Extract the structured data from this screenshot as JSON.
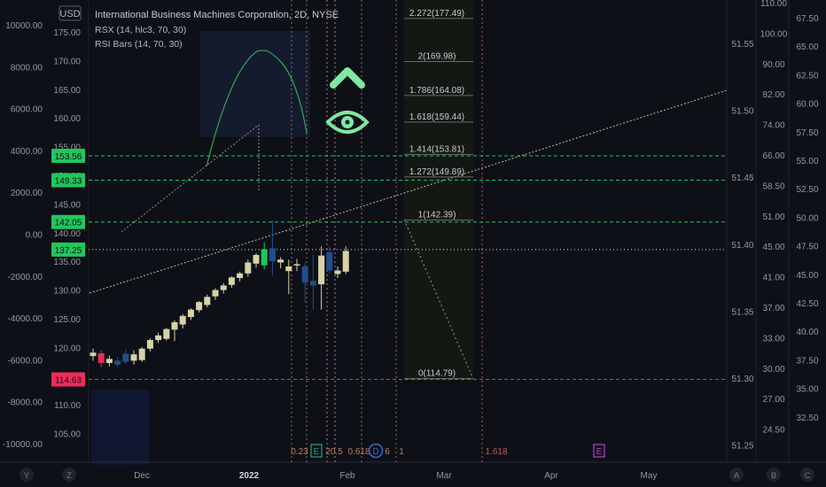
{
  "header": {
    "currency_badge": "USD",
    "title": "International Business Machines Corporation, 2D, NYSE",
    "indicators": [
      "RSX (14, hlc3, 70, 30)",
      "RSI Bars (14, 70, 30)"
    ]
  },
  "colors": {
    "background": "#0d1017",
    "up_candle": "#d8d2a8",
    "down_candle": "#1f4e8c",
    "bull_candle": "#22c55e",
    "bear_candle": "#ef2b5a",
    "green_line": "#22c55e",
    "red_line": "#ef2b5a",
    "fib_line": "#7a7a7a",
    "arrow": "#7ee8a0"
  },
  "axes": {
    "far_left": [
      "10000.00",
      "8000.00",
      "6000.00",
      "4000.00",
      "2000.00",
      "0.00",
      "-2000.00",
      "-4000.00",
      "-6000.00",
      "-8000.00",
      "-10000.00"
    ],
    "price": [
      "175.00",
      "170.00",
      "165.00",
      "160.00",
      "155.00",
      "150.00",
      "145.00",
      "140.00",
      "135.00",
      "130.00",
      "125.00",
      "120.00",
      "115.00",
      "110.00",
      "105.00"
    ],
    "mid_right": [
      "51.55",
      "51.50",
      "51.45",
      "51.40",
      "51.35",
      "51.30",
      "51.25"
    ],
    "right_a": [
      "110.00",
      "100.00",
      "90.00",
      "82.00",
      "74.00",
      "66.00",
      "58.50",
      "51.00",
      "45.00",
      "41.00",
      "37.00",
      "33.00",
      "30.00",
      "27.00",
      "24.50"
    ],
    "right_b": [
      "67.50",
      "65.00",
      "62.50",
      "60.00",
      "57.50",
      "55.00",
      "52.50",
      "50.00",
      "47.50",
      "45.00",
      "42.50",
      "40.00",
      "37.50",
      "35.00",
      "32.50"
    ],
    "time": [
      "Dec",
      "2022",
      "Feb",
      "Mar",
      "Apr",
      "May"
    ],
    "bottom_buttons": [
      "Y",
      "Z",
      "A",
      "B",
      "C"
    ]
  },
  "price_tags": [
    {
      "label": "153.56",
      "color": "#22c55e"
    },
    {
      "label": "149.33",
      "color": "#22c55e"
    },
    {
      "label": "142.05",
      "color": "#22c55e"
    },
    {
      "label": "137.25",
      "color": "#22c55e"
    },
    {
      "label": "114.63",
      "color": "#ef2b5a"
    }
  ],
  "fib_levels": [
    "2.272(177.49)",
    "2(169.98)",
    "1.786(164.08)",
    "1.618(159.44)",
    "1.414(153.81)",
    "1.272(149.89)",
    "1(142.39)",
    "0(114.79)"
  ],
  "bottom_labels": {
    "items": [
      "0.23",
      "E",
      "20.5",
      "0.618",
      "D",
      "6",
      "1",
      "1.618",
      "E"
    ]
  },
  "chart_data": {
    "type": "candlestick",
    "title": "International Business Machines Corporation, 2D, NYSE",
    "ylim": [
      102,
      179
    ],
    "candles": [
      {
        "o": 118.7,
        "h": 120.0,
        "l": 117.9,
        "c": 119.3
      },
      {
        "o": 119.2,
        "h": 119.7,
        "l": 116.8,
        "c": 117.5
      },
      {
        "o": 117.5,
        "h": 118.8,
        "l": 116.9,
        "c": 118.2
      },
      {
        "o": 117.9,
        "h": 118.5,
        "l": 116.8,
        "c": 117.2
      },
      {
        "o": 119.1,
        "h": 119.9,
        "l": 117.3,
        "c": 117.7
      },
      {
        "o": 117.9,
        "h": 119.7,
        "l": 117.2,
        "c": 119.0
      },
      {
        "o": 118.0,
        "h": 120.3,
        "l": 117.7,
        "c": 120.0
      },
      {
        "o": 120.0,
        "h": 121.8,
        "l": 119.5,
        "c": 121.5
      },
      {
        "o": 121.5,
        "h": 122.8,
        "l": 121.0,
        "c": 122.3
      },
      {
        "o": 121.7,
        "h": 123.6,
        "l": 121.4,
        "c": 123.4
      },
      {
        "o": 123.3,
        "h": 124.9,
        "l": 121.3,
        "c": 124.6
      },
      {
        "o": 124.2,
        "h": 126.0,
        "l": 123.5,
        "c": 125.7
      },
      {
        "o": 125.5,
        "h": 127.0,
        "l": 125.0,
        "c": 126.8
      },
      {
        "o": 126.7,
        "h": 128.3,
        "l": 126.3,
        "c": 128.1
      },
      {
        "o": 127.6,
        "h": 129.4,
        "l": 127.2,
        "c": 129.0
      },
      {
        "o": 129.1,
        "h": 130.5,
        "l": 128.5,
        "c": 130.2
      },
      {
        "o": 130.2,
        "h": 131.4,
        "l": 129.6,
        "c": 131.0
      },
      {
        "o": 131.1,
        "h": 132.6,
        "l": 130.6,
        "c": 132.4
      },
      {
        "o": 132.3,
        "h": 133.4,
        "l": 131.7,
        "c": 133.1
      },
      {
        "o": 133.1,
        "h": 135.5,
        "l": 132.5,
        "c": 135.0
      },
      {
        "o": 134.8,
        "h": 136.6,
        "l": 134.1,
        "c": 136.3
      },
      {
        "o": 134.5,
        "h": 138.5,
        "l": 133.8,
        "c": 137.3
      },
      {
        "o": 137.5,
        "h": 142.3,
        "l": 132.7,
        "c": 135.2
      },
      {
        "o": 135.0,
        "h": 135.9,
        "l": 134.0,
        "c": 135.5
      },
      {
        "o": 133.5,
        "h": 135.5,
        "l": 129.5,
        "c": 134.3
      },
      {
        "o": 134.5,
        "h": 135.6,
        "l": 133.5,
        "c": 134.7
      },
      {
        "o": 134.3,
        "h": 135.0,
        "l": 128.0,
        "c": 131.5
      },
      {
        "o": 131.8,
        "h": 136.3,
        "l": 126.8,
        "c": 131.0
      },
      {
        "o": 131.2,
        "h": 137.8,
        "l": 126.8,
        "c": 136.2
      },
      {
        "o": 136.8,
        "h": 137.9,
        "l": 133.0,
        "c": 133.6
      },
      {
        "o": 133.0,
        "h": 134.3,
        "l": 132.3,
        "c": 133.6
      },
      {
        "o": 133.4,
        "h": 137.8,
        "l": 133.0,
        "c": 137.0
      }
    ]
  }
}
